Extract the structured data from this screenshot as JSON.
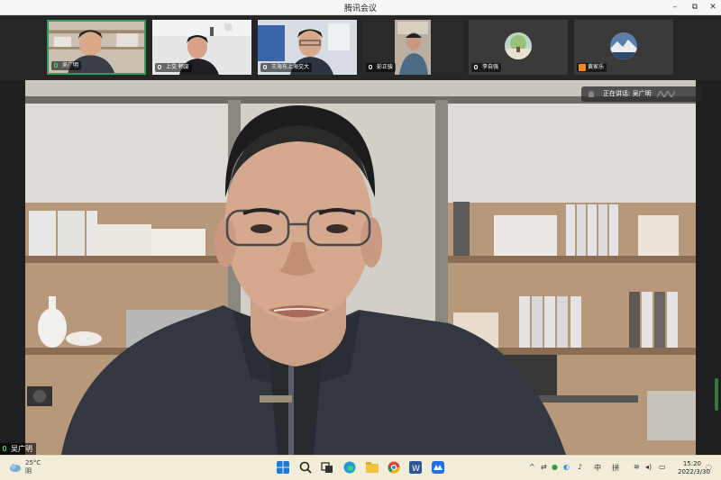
{
  "window": {
    "title": "腾讯会议",
    "controls": {
      "minimize": "–",
      "restore": "⧉",
      "close": "✕"
    }
  },
  "participants": [
    {
      "name": "吴广明",
      "active": true,
      "mic": "on"
    },
    {
      "name": "上交 韩废",
      "active": false,
      "mic": "muted"
    },
    {
      "name": "王海东上海交大",
      "active": false,
      "mic": "muted"
    },
    {
      "name": "彭正骏",
      "active": false,
      "mic": "muted"
    },
    {
      "name": "李自强",
      "active": false,
      "mic": "muted"
    },
    {
      "name": "黄家乐",
      "active": false,
      "mic": "muted"
    }
  ],
  "speaking": {
    "text": "正在讲话: 吴广明"
  },
  "main_speaker": {
    "name": "吴广明"
  },
  "taskbar": {
    "weather": {
      "temp": "25°C",
      "condition": "阴"
    },
    "ime": "中",
    "ime2": "拼",
    "clock": {
      "time": "15:20",
      "date": "2022/3/30"
    }
  },
  "colors": {
    "active_border": "#2f9e5f",
    "taskbar_bg": "#f1edd8",
    "strip_bg": "#262626"
  }
}
